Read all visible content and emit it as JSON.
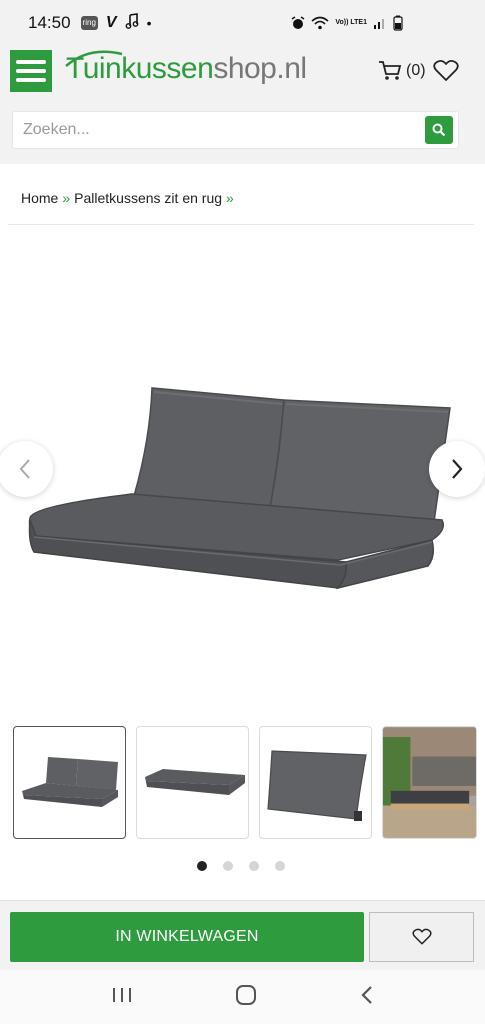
{
  "status_bar": {
    "time": "14:50",
    "ring_badge": "ring",
    "volte_label": "Vo)) LTE1"
  },
  "header": {
    "logo_part_green": "Tuinkussen",
    "logo_part_gray": "shop.nl",
    "cart_count": "(0)",
    "search_placeholder": "Zoeken..."
  },
  "breadcrumb": {
    "items": [
      "Home",
      "Palletkussens zit en rug"
    ],
    "separator": "»"
  },
  "gallery": {
    "thumbnail_count": 4,
    "active_index": 0
  },
  "bottom_bar": {
    "add_to_cart_label": "IN WINKELWAGEN"
  },
  "colors": {
    "brand_green": "#2e9b3e",
    "cushion_gray": "#5e5f63"
  }
}
